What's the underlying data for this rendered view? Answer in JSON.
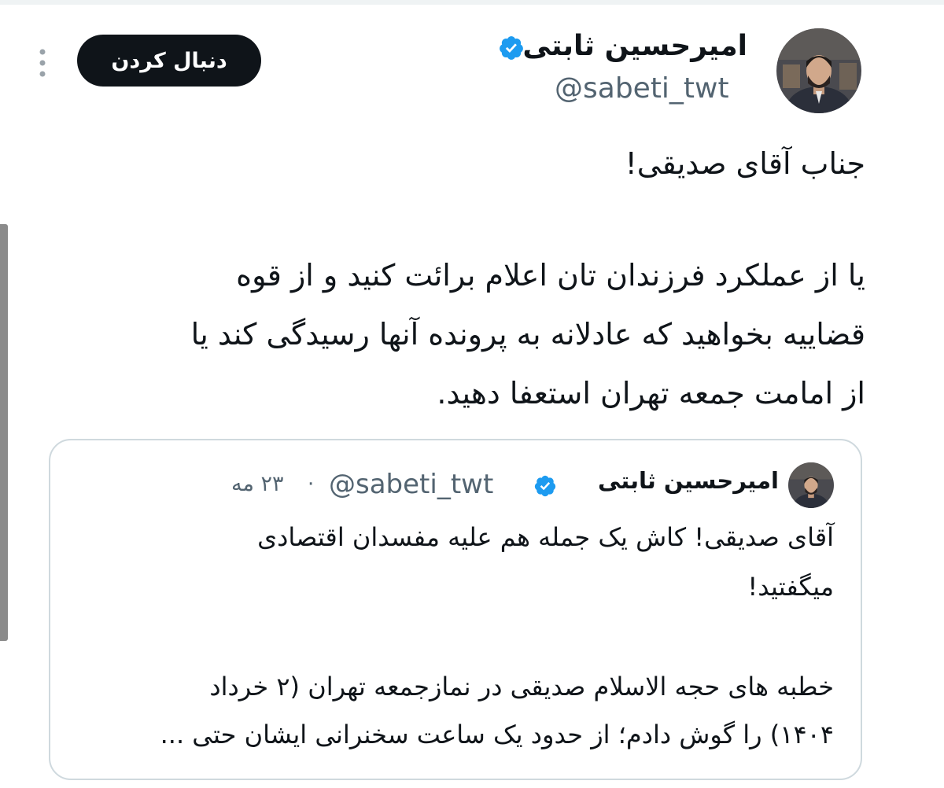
{
  "tweet": {
    "author_name": "امیرحسین ثابتی",
    "author_handle": "@sabeti_twt",
    "follow_label": "دنبال کردن",
    "text_lines": [
      "جناب آقای صدیقی!",
      "یا از عملکرد فرزندان تان اعلام برائت کنید و از قوه",
      "قضاییه بخواهید که عادلانه به پرونده آنها رسیدگی کند یا",
      "از امامت جمعه تهران استعفا دهید."
    ]
  },
  "quoted": {
    "author_name": "امیرحسین ثابتی",
    "author_handle": "@sabeti_twt",
    "separator": "·",
    "date": "۲۳ مه",
    "text_lines": [
      "آقای صدیقی! کاش یک جمله هم علیه مفسدان اقتصادی",
      "میگفتید!",
      "خطبه های حجه الاسلام صدیقی در نمازجمعه تهران (۲ خرداد",
      "۱۴۰۴) را گوش دادم؛ از حدود یک ساعت سخنرانی ایشان حتی ..."
    ]
  },
  "icons": {
    "verified": "verified-badge-icon",
    "more": "more-vertical-icon"
  },
  "colors": {
    "verified": "#1d9bf0",
    "follow_bg": "#0f1419",
    "secondary_text": "#536471",
    "border": "#cfd9de"
  }
}
